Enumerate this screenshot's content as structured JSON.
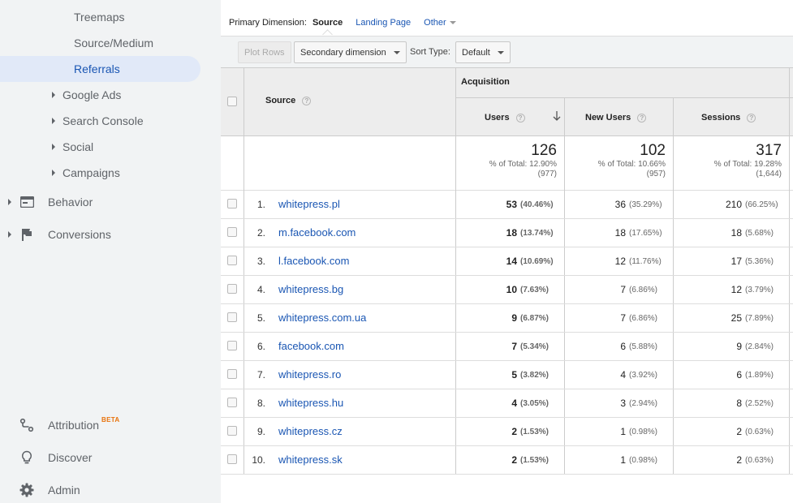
{
  "sidebar": {
    "sub_items": [
      {
        "label": "Treemaps"
      },
      {
        "label": "Source/Medium"
      },
      {
        "label": "Referrals"
      }
    ],
    "acq_groups": [
      {
        "label": "Google Ads"
      },
      {
        "label": "Search Console"
      },
      {
        "label": "Social"
      },
      {
        "label": "Campaigns"
      }
    ],
    "sections": [
      {
        "label": "Behavior",
        "icon": "behavior-icon"
      },
      {
        "label": "Conversions",
        "icon": "flag-icon"
      }
    ],
    "bottom": [
      {
        "label": "Attribution",
        "badge": "BETA",
        "icon": "attribution-icon"
      },
      {
        "label": "Discover",
        "icon": "lightbulb-icon"
      },
      {
        "label": "Admin",
        "icon": "gear-icon"
      }
    ]
  },
  "primary_dimension": {
    "label": "Primary Dimension:",
    "current": "Source",
    "options": [
      "Landing Page",
      "Other"
    ]
  },
  "toolbar": {
    "plot_rows": "Plot Rows",
    "secondary_dimension": "Secondary dimension",
    "sort_type_label": "Sort Type:",
    "sort_type_value": "Default"
  },
  "table": {
    "source_header": "Source",
    "group_header": "Acquisition",
    "columns": [
      "Users",
      "New Users",
      "Sessions"
    ],
    "totals": [
      {
        "value": "126",
        "pct": "% of Total: 12.90%",
        "total": "(977)"
      },
      {
        "value": "102",
        "pct": "% of Total: 10.66%",
        "total": "(957)"
      },
      {
        "value": "317",
        "pct": "% of Total: 19.28%",
        "total": "(1,644)"
      }
    ],
    "rows": [
      {
        "num": "1.",
        "source": "whitepress.pl",
        "users": "53",
        "users_pct": "(40.46%)",
        "new_users": "36",
        "new_users_pct": "(35.29%)",
        "sessions": "210",
        "sessions_pct": "(66.25%)"
      },
      {
        "num": "2.",
        "source": "m.facebook.com",
        "users": "18",
        "users_pct": "(13.74%)",
        "new_users": "18",
        "new_users_pct": "(17.65%)",
        "sessions": "18",
        "sessions_pct": "(5.68%)"
      },
      {
        "num": "3.",
        "source": "l.facebook.com",
        "users": "14",
        "users_pct": "(10.69%)",
        "new_users": "12",
        "new_users_pct": "(11.76%)",
        "sessions": "17",
        "sessions_pct": "(5.36%)"
      },
      {
        "num": "4.",
        "source": "whitepress.bg",
        "users": "10",
        "users_pct": "(7.63%)",
        "new_users": "7",
        "new_users_pct": "(6.86%)",
        "sessions": "12",
        "sessions_pct": "(3.79%)"
      },
      {
        "num": "5.",
        "source": "whitepress.com.ua",
        "users": "9",
        "users_pct": "(6.87%)",
        "new_users": "7",
        "new_users_pct": "(6.86%)",
        "sessions": "25",
        "sessions_pct": "(7.89%)"
      },
      {
        "num": "6.",
        "source": "facebook.com",
        "users": "7",
        "users_pct": "(5.34%)",
        "new_users": "6",
        "new_users_pct": "(5.88%)",
        "sessions": "9",
        "sessions_pct": "(2.84%)"
      },
      {
        "num": "7.",
        "source": "whitepress.ro",
        "users": "5",
        "users_pct": "(3.82%)",
        "new_users": "4",
        "new_users_pct": "(3.92%)",
        "sessions": "6",
        "sessions_pct": "(1.89%)"
      },
      {
        "num": "8.",
        "source": "whitepress.hu",
        "users": "4",
        "users_pct": "(3.05%)",
        "new_users": "3",
        "new_users_pct": "(2.94%)",
        "sessions": "8",
        "sessions_pct": "(2.52%)"
      },
      {
        "num": "9.",
        "source": "whitepress.cz",
        "users": "2",
        "users_pct": "(1.53%)",
        "new_users": "1",
        "new_users_pct": "(0.98%)",
        "sessions": "2",
        "sessions_pct": "(0.63%)"
      },
      {
        "num": "10.",
        "source": "whitepress.sk",
        "users": "2",
        "users_pct": "(1.53%)",
        "new_users": "1",
        "new_users_pct": "(0.98%)",
        "sessions": "2",
        "sessions_pct": "(0.63%)"
      }
    ]
  },
  "colors": {
    "sidebar_bg": "#f1f3f4",
    "active_bg": "#e1e9f8",
    "link": "#1a56b3",
    "beta": "#e8710a"
  }
}
